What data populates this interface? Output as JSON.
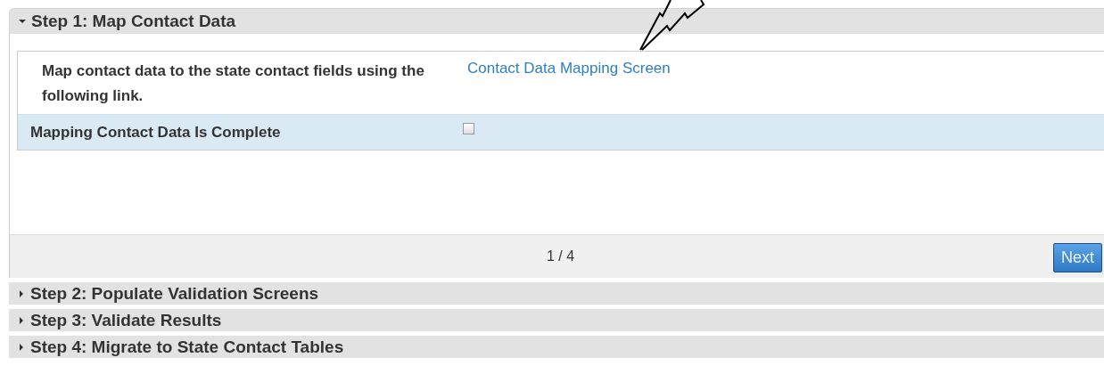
{
  "steps": [
    {
      "title": "Step 1: Map Contact Data",
      "expanded": true,
      "content": {
        "rows": [
          {
            "kind": "link",
            "label": "Map contact data to the state contact fields using the following link.",
            "link": "Contact Data Mapping Screen"
          },
          {
            "kind": "checkbox",
            "label": "Mapping Contact Data Is Complete",
            "checked": false
          }
        ],
        "pager": "1 / 4",
        "next_button": "Next"
      }
    },
    {
      "title": "Step 2: Populate Validation Screens",
      "expanded": false
    },
    {
      "title": "Step 3: Validate Results",
      "expanded": false
    },
    {
      "title": "Step 4: Migrate to State Contact Tables",
      "expanded": false
    }
  ]
}
